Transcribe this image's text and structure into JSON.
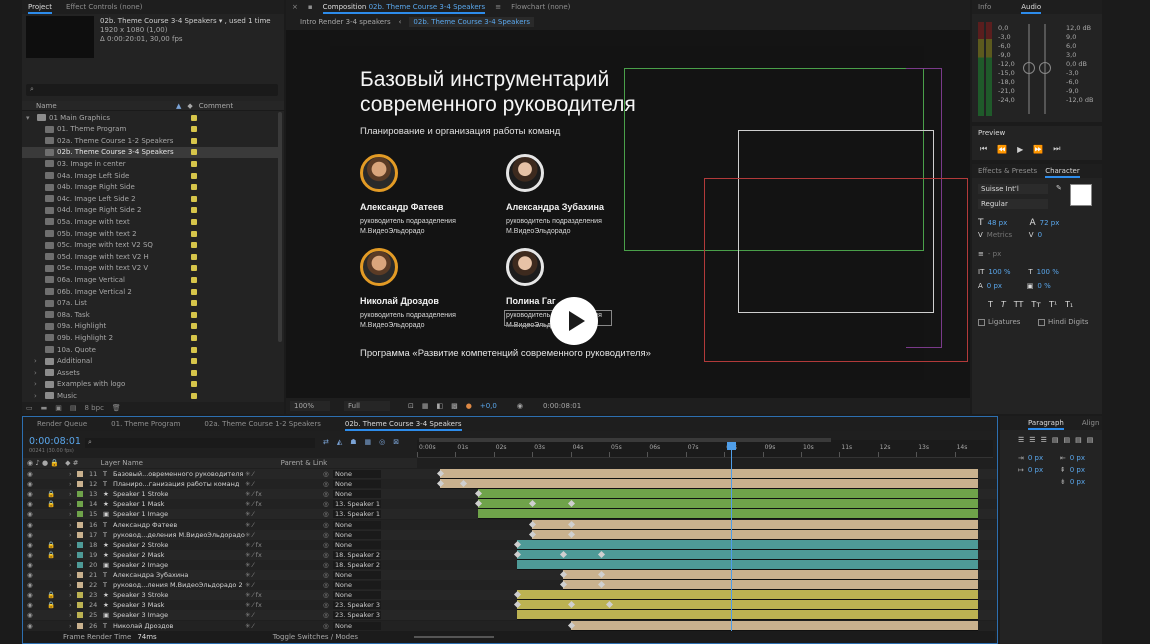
{
  "project": {
    "tab_project": "Project",
    "tab_effects": "Effect Controls (none)",
    "sel_name": "02b. Theme Course 3-4 Speakers ▾ , used 1 time",
    "sel_size": "1920 x 1080 (1,00)",
    "sel_dur": "Δ 0:00:20:01, 30,00 fps",
    "col_name": "Name",
    "col_comment": "Comment",
    "bpc": "8 bpc",
    "items": [
      {
        "n": "01 Main Graphics",
        "t": "folder",
        "l": 0
      },
      {
        "n": "01. Theme Program",
        "t": "comp",
        "l": 1
      },
      {
        "n": "02a. Theme Course 1-2 Speakers",
        "t": "comp",
        "l": 1
      },
      {
        "n": "02b. Theme Course 3-4 Speakers",
        "t": "comp",
        "l": 1,
        "sel": true
      },
      {
        "n": "03. Image in center",
        "t": "comp",
        "l": 1
      },
      {
        "n": "04a. Image Left Side",
        "t": "comp",
        "l": 1
      },
      {
        "n": "04b. Image Right Side",
        "t": "comp",
        "l": 1
      },
      {
        "n": "04c. Image Left Side 2",
        "t": "comp",
        "l": 1
      },
      {
        "n": "04d. Image Right Side 2",
        "t": "comp",
        "l": 1
      },
      {
        "n": "05a. Image with text",
        "t": "comp",
        "l": 1
      },
      {
        "n": "05b. Image with text 2",
        "t": "comp",
        "l": 1
      },
      {
        "n": "05c. Image with text V2 SQ",
        "t": "comp",
        "l": 1
      },
      {
        "n": "05d. Image with text V2 H",
        "t": "comp",
        "l": 1
      },
      {
        "n": "05e. Image with text V2 V",
        "t": "comp",
        "l": 1
      },
      {
        "n": "06a. Image Vertical",
        "t": "comp",
        "l": 1
      },
      {
        "n": "06b. Image Vertical 2",
        "t": "comp",
        "l": 1
      },
      {
        "n": "07a. List",
        "t": "comp",
        "l": 1
      },
      {
        "n": "08a. Task",
        "t": "comp",
        "l": 1
      },
      {
        "n": "09a. Highlight",
        "t": "comp",
        "l": 1
      },
      {
        "n": "09b. Highlight 2",
        "t": "comp",
        "l": 1
      },
      {
        "n": "10a. Quote",
        "t": "comp",
        "l": 1
      },
      {
        "n": "Additional",
        "t": "folder",
        "l": 1
      },
      {
        "n": "Assets",
        "t": "folder",
        "l": 1
      },
      {
        "n": "Examples with logo",
        "t": "folder",
        "l": 1
      },
      {
        "n": "Music",
        "t": "folder",
        "l": 1
      }
    ]
  },
  "comp": {
    "tab_comp": "Composition",
    "comp_name": "02b. Theme Course 3-4 Speakers",
    "flowchart": "Flowchart (none)",
    "crumb1": "Intro Render 3-4 speakers",
    "crumb2": "02b. Theme Course 3-4 Speakers",
    "zoom": "100%",
    "res": "Full",
    "exposure": "+0,0",
    "timecode": "0:00:08:01"
  },
  "slide": {
    "title1": "Базовый инструментарий",
    "title2": "современного руководителя",
    "subtitle": "Планирование и организация работы команд",
    "footer": "Программа «Развитие компетенций современного руководителя»",
    "speakers": [
      {
        "name": "Александр Фатеев",
        "role1": "руководитель подразделения",
        "role2": "М.ВидеоЭльдорадо"
      },
      {
        "name": "Александра Зубахина",
        "role1": "руководитель подразделения",
        "role2": "М.ВидеоЭльдорадо"
      },
      {
        "name": "Николай Дроздов",
        "role1": "руководитель подразделения",
        "role2": "М.ВидеоЭльдорадо"
      },
      {
        "name": "Полина Гаг",
        "role1": "руководитель подразделения",
        "role2": "М.ВидеоЭльдорадо"
      }
    ]
  },
  "info": {
    "tab_info": "Info",
    "tab_audio": "Audio",
    "db_left": [
      "0,0",
      "-3,0",
      "-6,0",
      "-9,0",
      "-12,0",
      "-15,0",
      "-18,0",
      "-21,0",
      "-24,0"
    ],
    "db_right": [
      "12,0 dB",
      "9,0",
      "6,0",
      "3,0",
      "0,0 dB",
      "-3,0",
      "-6,0",
      "-9,0",
      "-12,0 dB"
    ]
  },
  "preview": {
    "title": "Preview"
  },
  "character": {
    "tab_effects": "Effects & Presets",
    "tab_char": "Character",
    "font": "Suisse Int'l",
    "style": "Regular",
    "size": "48 px",
    "leading": "72 px",
    "kerning": "Metrics",
    "tracking": "0",
    "stroke_unit": "- px",
    "vscale": "100 %",
    "hscale": "100 %",
    "baseline": "0 px",
    "tsume": "0 %",
    "ligatures": "Ligatures",
    "hindi": "Hindi Digits"
  },
  "paragraph": {
    "tab_para": "Paragraph",
    "tab_align": "Align",
    "indent1": "0 px",
    "indent2": "0 px",
    "indent3": "0 px",
    "space1": "0 px",
    "space2": "0 px"
  },
  "timeline": {
    "tabs": [
      "Render Queue",
      "01. Theme Program",
      "02a. Theme Course 1-2 Speakers",
      "02b. Theme Course 3-4 Speakers"
    ],
    "time": "0:00:08:01",
    "fps": "00241 (30.00 fps)",
    "col_layer": "Layer Name",
    "col_parent": "Parent & Link",
    "ruler": [
      "0:00s",
      "01s",
      "02s",
      "03s",
      "04s",
      "05s",
      "06s",
      "07s",
      "08s",
      "09s",
      "10s",
      "11s",
      "12s",
      "13s",
      "14s"
    ],
    "footer_render": "Frame Render Time",
    "footer_ms": "74ms",
    "footer_toggle": "Toggle Switches / Modes",
    "layers": [
      {
        "num": "11",
        "type": "T",
        "name": "Базовый...овременного руководителя",
        "parent": "None",
        "color": "#c9b18e",
        "start": 0.6,
        "end": 14.6,
        "kf": [
          0.6
        ]
      },
      {
        "num": "12",
        "type": "T",
        "name": "Планиро...ганизация работы команд",
        "parent": "None",
        "color": "#c9b18e",
        "start": 0.6,
        "end": 14.6,
        "kf": [
          0.6,
          1.2
        ]
      },
      {
        "num": "13",
        "type": "★",
        "name": "Speaker 1 Stroke",
        "parent": "None",
        "color": "#6fa34a",
        "start": 1.6,
        "end": 14.6,
        "kf": [
          1.6
        ]
      },
      {
        "num": "14",
        "type": "★",
        "name": "Speaker 1 Mask",
        "parent": "13. Speaker 1",
        "color": "#6fa34a",
        "start": 1.6,
        "end": 14.6,
        "kf": [
          1.6,
          3.0,
          4.0
        ]
      },
      {
        "num": "15",
        "type": "▣",
        "name": "Speaker 1 Image",
        "parent": "13. Speaker 1",
        "color": "#6fa34a",
        "start": 1.6,
        "end": 14.6,
        "kf": []
      },
      {
        "num": "16",
        "type": "T",
        "name": "Александр Фатеев",
        "parent": "None",
        "color": "#c9b18e",
        "start": 3.0,
        "end": 14.6,
        "kf": [
          3.0,
          4.0
        ]
      },
      {
        "num": "17",
        "type": "T",
        "name": "руковод...деления М.ВидеоЭльдорадо",
        "parent": "None",
        "color": "#c9b18e",
        "start": 3.0,
        "end": 14.6,
        "kf": [
          3.0,
          4.0
        ]
      },
      {
        "num": "18",
        "type": "★",
        "name": "Speaker 2 Stroke",
        "parent": "None",
        "color": "#4e9a97",
        "start": 2.6,
        "end": 14.6,
        "kf": [
          2.6
        ]
      },
      {
        "num": "19",
        "type": "★",
        "name": "Speaker 2 Mask",
        "parent": "18. Speaker 2",
        "color": "#4e9a97",
        "start": 2.6,
        "end": 14.6,
        "kf": [
          2.6,
          3.8,
          4.8
        ]
      },
      {
        "num": "20",
        "type": "▣",
        "name": "Speaker 2 Image",
        "parent": "18. Speaker 2",
        "color": "#4e9a97",
        "start": 2.6,
        "end": 14.6,
        "kf": []
      },
      {
        "num": "21",
        "type": "T",
        "name": "Александра Зубахина",
        "parent": "None",
        "color": "#c9b18e",
        "start": 3.8,
        "end": 14.6,
        "kf": [
          3.8,
          4.8
        ]
      },
      {
        "num": "22",
        "type": "T",
        "name": "руковод...ления М.ВидеоЭльдорадо 2",
        "parent": "None",
        "color": "#c9b18e",
        "start": 3.8,
        "end": 14.6,
        "kf": [
          3.8,
          4.8
        ]
      },
      {
        "num": "23",
        "type": "★",
        "name": "Speaker 3 Stroke",
        "parent": "None",
        "color": "#bcb252",
        "start": 2.6,
        "end": 14.6,
        "kf": [
          2.6
        ]
      },
      {
        "num": "24",
        "type": "★",
        "name": "Speaker 3 Mask",
        "parent": "23. Speaker 3",
        "color": "#bcb252",
        "start": 2.6,
        "end": 14.6,
        "kf": [
          2.6,
          4.0,
          5.0
        ]
      },
      {
        "num": "25",
        "type": "▣",
        "name": "Speaker 3 Image",
        "parent": "23. Speaker 3",
        "color": "#bcb252",
        "start": 2.6,
        "end": 14.6,
        "kf": []
      },
      {
        "num": "26",
        "type": "T",
        "name": "Николай Дроздов",
        "parent": "None",
        "color": "#c9b18e",
        "start": 4.0,
        "end": 14.6,
        "kf": [
          4.0
        ]
      }
    ]
  }
}
